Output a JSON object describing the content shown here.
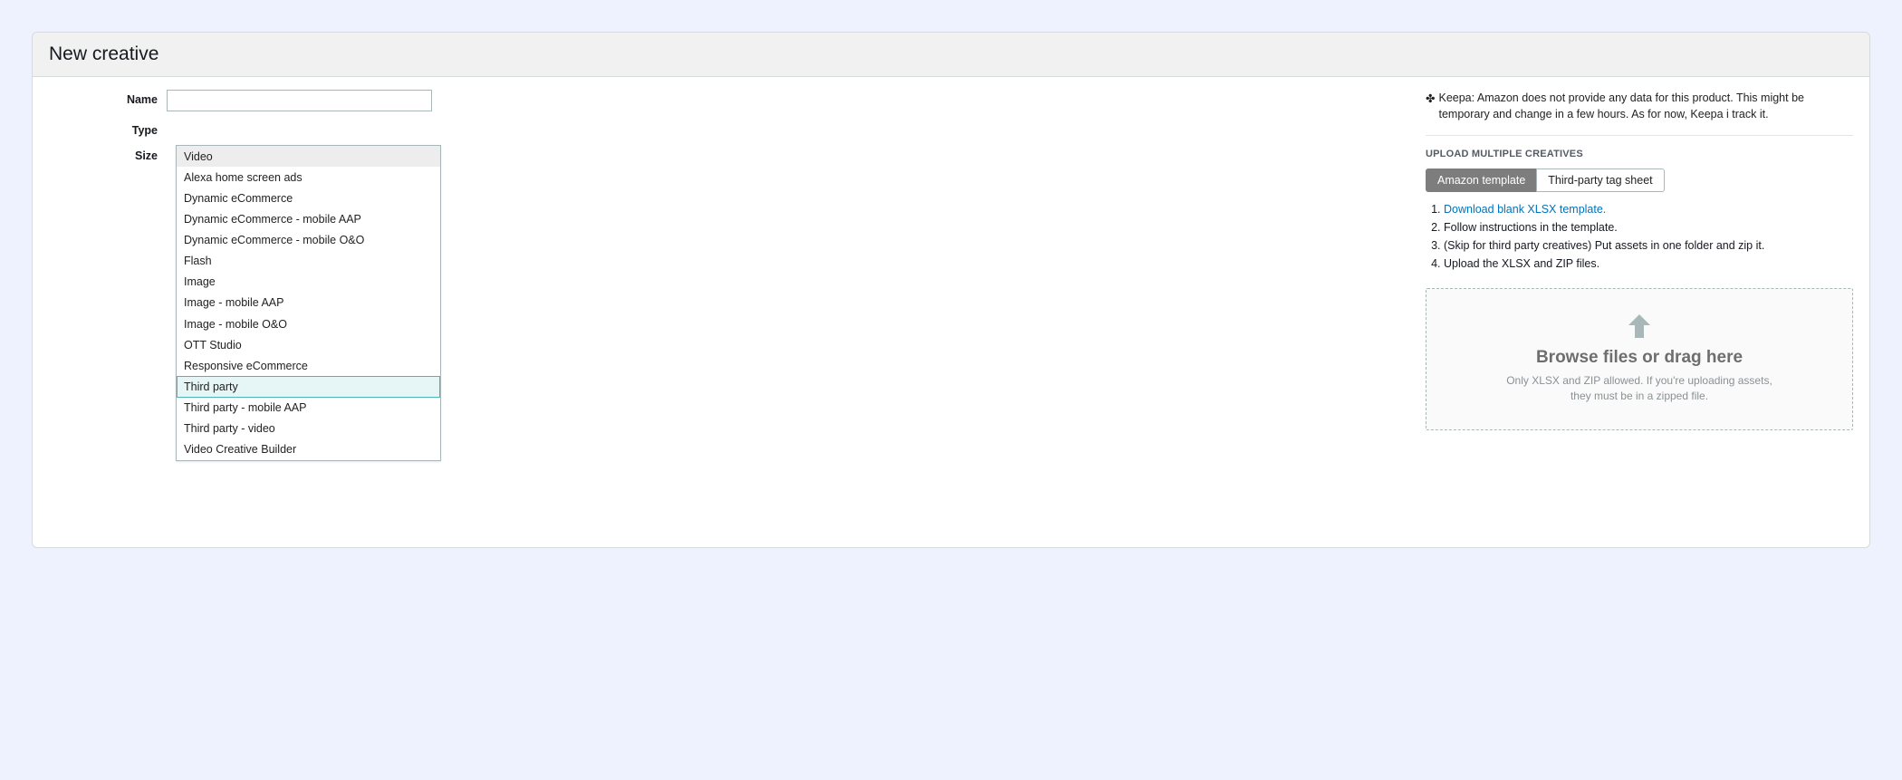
{
  "header": {
    "title": "New creative"
  },
  "form": {
    "name_label": "Name",
    "name_value": "",
    "type_label": "Type",
    "size_label": "Size",
    "type_options": [
      "Video",
      "Alexa home screen ads",
      "Dynamic eCommerce",
      "Dynamic eCommerce - mobile AAP",
      "Dynamic eCommerce - mobile O&O",
      "Flash",
      "Image",
      "Image - mobile AAP",
      "Image - mobile O&O",
      "OTT Studio",
      "Responsive eCommerce",
      "Third party",
      "Third party - mobile AAP",
      "Third party - video",
      "Video Creative Builder"
    ],
    "type_selected_index": 0,
    "type_highlight_index": 11
  },
  "right": {
    "keepa_glyph": "✤",
    "keepa_text": "Keepa: Amazon does not provide any data for this product. This might be temporary and change in a few hours. As for now, Keepa i track it.",
    "upload_section_title": "UPLOAD MULTIPLE CREATIVES",
    "tabs": {
      "amazon": "Amazon template",
      "thirdparty": "Third-party tag sheet"
    },
    "steps": [
      {
        "prefix": "",
        "link": "Download blank XLSX template.",
        "suffix": ""
      },
      {
        "text": "Follow instructions in the template."
      },
      {
        "text": "(Skip for third party creatives) Put assets in one folder and zip it."
      },
      {
        "text": "Upload the XLSX and ZIP files."
      }
    ],
    "dropzone": {
      "title": "Browse files or drag here",
      "subtitle": "Only XLSX and ZIP allowed. If you're uploading assets, they must be in a zipped file."
    }
  }
}
